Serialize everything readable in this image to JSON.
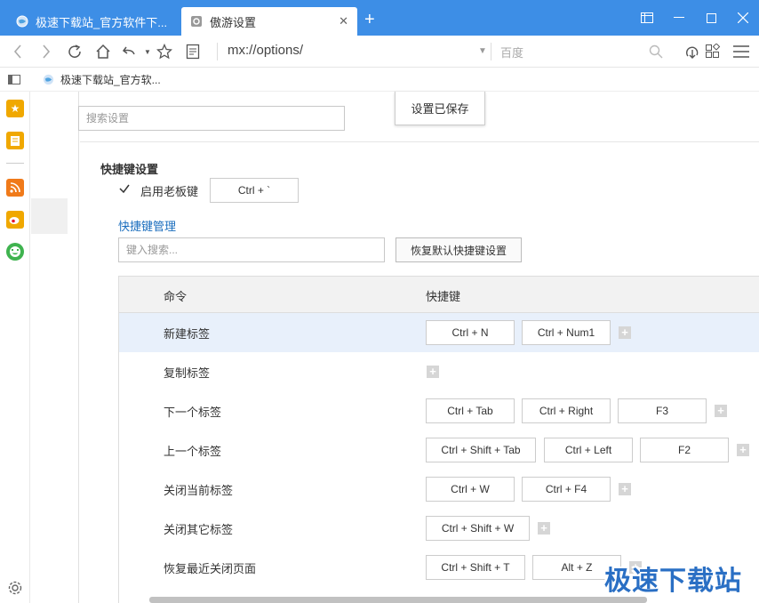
{
  "tabs": [
    {
      "title": "极速下载站_官方软件下...",
      "active": false
    },
    {
      "title": "傲游设置",
      "active": true
    }
  ],
  "toolbar": {
    "address": "mx://options/",
    "search_placeholder": "百度"
  },
  "bookmarks": [
    {
      "label": "极速下载站_官方软..."
    }
  ],
  "sidepanel": {
    "icons": [
      "star-icon",
      "note-icon",
      "rss-icon",
      "weibo-icon",
      "smile-icon"
    ],
    "colors": {
      "star": "#f0a800",
      "note": "#f0a800",
      "rss": "#f07a1a",
      "weibo": "#f0a800",
      "smile": "#3fb34f"
    }
  },
  "settings": {
    "search_placeholder": "搜索设置",
    "saved_toast": "设置已保存"
  },
  "shortcuts": {
    "section_title": "快捷键设置",
    "boss_key": {
      "label": "启用老板键",
      "checked": true,
      "value": "Ctrl + `"
    },
    "manage_title": "快捷键管理",
    "search_placeholder": "键入搜索...",
    "restore_button": "恢复默认快捷键设置",
    "columns": {
      "command": "命令",
      "shortcut": "快捷键"
    },
    "rows": [
      {
        "command": "新建标签",
        "keys": [
          "Ctrl + N",
          "Ctrl + Num1"
        ],
        "highlighted": true
      },
      {
        "command": "复制标签",
        "keys": []
      },
      {
        "command": "下一个标签",
        "keys": [
          "Ctrl + Tab",
          "Ctrl + Right",
          "F3"
        ]
      },
      {
        "command": "上一个标签",
        "keys": [
          "Ctrl + Shift + Tab",
          "Ctrl + Left",
          "F2"
        ]
      },
      {
        "command": "关闭当前标签",
        "keys": [
          "Ctrl + W",
          "Ctrl + F4"
        ]
      },
      {
        "command": "关闭其它标签",
        "keys": [
          "Ctrl + Shift + W"
        ]
      },
      {
        "command": "恢复最近关闭页面",
        "keys": [
          "Ctrl + Shift + T",
          "Alt + Z"
        ]
      }
    ]
  },
  "watermark": "极速下载站",
  "colors": {
    "accent": "#3d8ee6",
    "link": "#1a6dbd",
    "row_highlight": "#e8f0fb"
  }
}
